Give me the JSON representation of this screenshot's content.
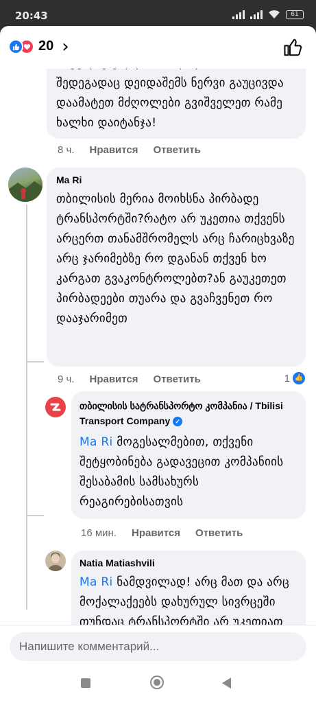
{
  "status": {
    "time": "20:43",
    "battery": "61"
  },
  "header": {
    "reaction_count": "20",
    "chevron": "›"
  },
  "comments": [
    {
      "text": "ახტელზე გლდახბი! დიდხახს ჩის შედეგადაც დეიდაშემს ნერვი გაუცივდა დაამატეთ მძღოლები გვიშველეთ რამე ხალხი დაიტანჯა!",
      "time": "8 ч.",
      "like_label": "Нравится",
      "reply_label": "Ответить"
    },
    {
      "author": "Ma Ri",
      "text": "თბილისის მერია მოიხსნა პირბადე ტრანსპორტში?რატო არ უკეთია თქვენს არცერთ თანამშრომელს არც ჩარიცხვაზე არც ჯარიმებზე რო დგანან თქვენ ხო კარგათ გვაკონტროლებთ?ან გაუკეთეთ პირბადეები თუარა და გვაჩვენეთ რო დააჯარიმეთ",
      "time": "9 ч.",
      "like_label": "Нравится",
      "reply_label": "Ответить",
      "likes": "1"
    }
  ],
  "replies": [
    {
      "author": "თბილისის სატრანსპორტო კომპანია  / Tbilisi Transport Company",
      "mention": "Ma Ri",
      "text": " მოგესალმებით, თქვენი შეტყობინება გადავეცით კომპანიის შესაბამის სამსახურს რეაგირებისათვის",
      "time": "16 мин.",
      "like_label": "Нравится",
      "reply_label": "Ответить"
    },
    {
      "author": "Natia Matiashvili",
      "mention": "Ma Ri",
      "text": " ნამდვილად! არც მათ და არც მოქალაქეებს დახურულ სივრცეში თუნდაც ტრანსპორტში არ უკეთიათ პირბადე და ფორმალურად არსებობს"
    }
  ],
  "composer": {
    "placeholder": "Напишите комментарий..."
  },
  "colors": {
    "accent": "#1877f2",
    "bubble": "#f0f2f5",
    "secondary_text": "#65676b"
  },
  "icons": [
    "like-reaction-icon",
    "love-reaction-icon",
    "thumbs-up-icon",
    "verified-icon",
    "page-logo-icon"
  ]
}
